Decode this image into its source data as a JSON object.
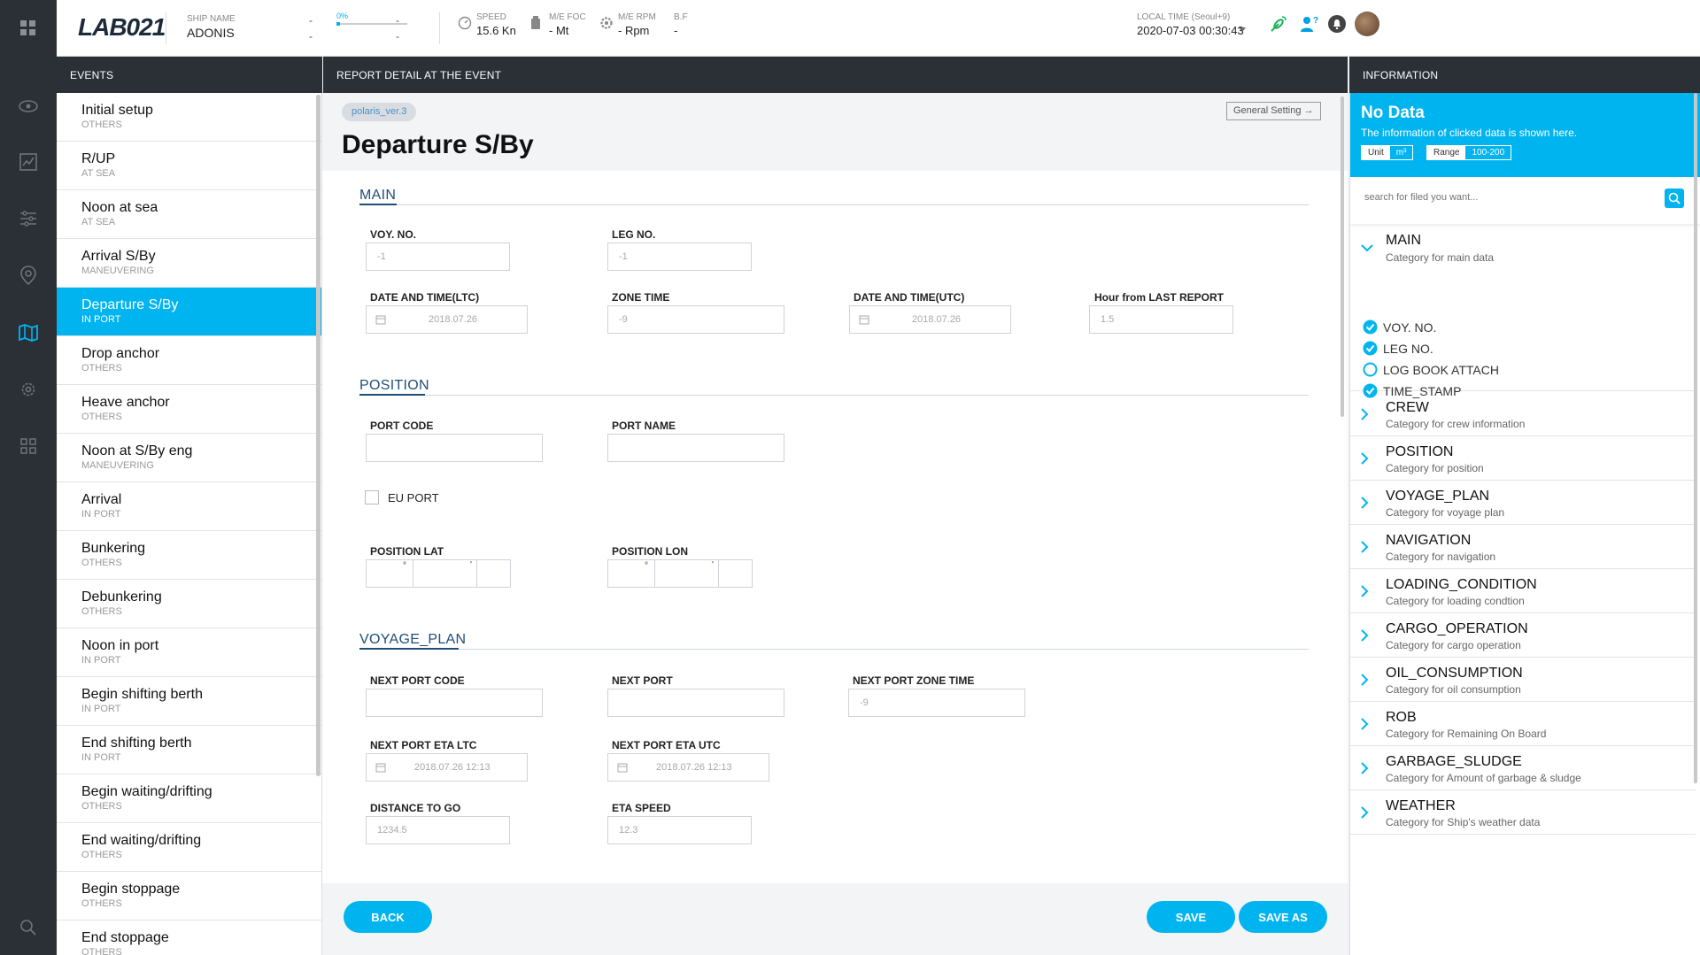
{
  "header": {
    "logo": "LAB021",
    "ship_name_label": "SHIP NAME",
    "ship_name": "ADONIS",
    "dash1a": "-",
    "dash1b": "-",
    "progress_label": "0%",
    "progress_fraction": 0.05,
    "dash2a": "-",
    "dash2b": "-",
    "speed_label": "SPEED",
    "speed_value": "15.6 Kn",
    "foc_label": "M/E FOC",
    "foc_value": "- Mt",
    "rpm_label": "M/E RPM",
    "rpm_value": "- Rpm",
    "bf_label": "B.F",
    "bf_value": "-",
    "time_label": "LOCAL TIME (Seoul+9)",
    "time_value": "2020-07-03 00:30:43"
  },
  "nav": {
    "icons": [
      "apps-icon",
      "eye-icon",
      "chart-icon",
      "sliders-icon",
      "location-icon",
      "map-icon",
      "settings-icon",
      "grid-icon",
      "search-icon"
    ]
  },
  "panels": {
    "events_title": "EVENTS",
    "report_title": "REPORT DETAIL AT THE EVENT",
    "info_title": "INFORMATION"
  },
  "events": [
    {
      "title": "Initial setup",
      "sub": "OTHERS"
    },
    {
      "title": "R/UP",
      "sub": "AT SEA"
    },
    {
      "title": "Noon at sea",
      "sub": "AT SEA"
    },
    {
      "title": "Arrival S/By",
      "sub": "MANEUVERING"
    },
    {
      "title": "Departure S/By",
      "sub": "IN PORT"
    },
    {
      "title": "Drop anchor",
      "sub": "OTHERS"
    },
    {
      "title": "Heave anchor",
      "sub": "OTHERS"
    },
    {
      "title": "Noon at S/By eng",
      "sub": "MANEUVERING"
    },
    {
      "title": "Arrival",
      "sub": "IN PORT"
    },
    {
      "title": "Bunkering",
      "sub": "OTHERS"
    },
    {
      "title": "Debunkering",
      "sub": "OTHERS"
    },
    {
      "title": "Noon in port",
      "sub": "IN PORT"
    },
    {
      "title": "Begin shifting berth",
      "sub": "IN PORT"
    },
    {
      "title": "End shifting berth",
      "sub": "IN PORT"
    },
    {
      "title": "Begin waiting/drifting",
      "sub": "OTHERS"
    },
    {
      "title": "End waiting/drifting",
      "sub": "OTHERS"
    },
    {
      "title": "Begin stoppage",
      "sub": "OTHERS"
    },
    {
      "title": "End stoppage",
      "sub": "OTHERS"
    }
  ],
  "report": {
    "version_tag": "polaris_ver.3",
    "general_setting": "General Setting →",
    "title": "Departure S/By",
    "main": {
      "heading": "MAIN",
      "voy_no_label": "VOY. NO.",
      "voy_no_value": "-1",
      "leg_no_label": "LEG NO.",
      "leg_no_value": "-1",
      "dt_ltc_label": "DATE AND TIME(LTC)",
      "dt_ltc_value": "2018.07.26",
      "zone_time_label": "ZONE TIME",
      "zone_time_value": "-9",
      "dt_utc_label": "DATE AND TIME(UTC)",
      "dt_utc_value": "2018.07.26",
      "hour_label": "Hour from LAST REPORT",
      "hour_value": "1.5"
    },
    "position": {
      "heading": "POSITION",
      "port_code_label": "PORT CODE",
      "port_code_value": "",
      "port_name_label": "PORT NAME",
      "port_name_value": "",
      "eu_port_label": "EU PORT",
      "lat_label": "POSITION LAT",
      "lon_label": "POSITION LON",
      "deg_mark": "°",
      "min_mark": "'"
    },
    "voyage_plan": {
      "heading": "VOYAGE_PLAN",
      "next_code_label": "NEXT PORT CODE",
      "next_code_value": "",
      "next_port_label": "NEXT PORT",
      "next_port_value": "",
      "next_zone_label": "NEXT PORT ZONE TIME",
      "next_zone_value": "-9",
      "eta_ltc_label": "NEXT PORT ETA LTC",
      "eta_ltc_value": "2018.07.26 12:13",
      "eta_utc_label": "NEXT PORT ETA UTC",
      "eta_utc_value": "2018.07.26 12:13",
      "dist_label": "DISTANCE TO GO",
      "dist_value": "1234.5",
      "eta_speed_label": "ETA SPEED",
      "eta_speed_value": "12.3"
    },
    "back": "BACK",
    "save": "SAVE",
    "save_as": "SAVE AS"
  },
  "info": {
    "title": "No Data",
    "desc": "The information of clicked data is shown here.",
    "unit_label": "Unit",
    "unit_value": "m³",
    "range_label": "Range",
    "range_value": "100-200",
    "search_placeholder": "search for filed you want...",
    "main": {
      "title": "MAIN",
      "sub": "Category for main data"
    },
    "checks": [
      {
        "label": "VOY. NO.",
        "checked": true
      },
      {
        "label": "LEG NO.",
        "checked": true
      },
      {
        "label": "LOG BOOK ATTACH",
        "checked": false
      },
      {
        "label": "TIME_STAMP",
        "checked": true
      }
    ],
    "categories": [
      {
        "title": "CREW",
        "sub": "Category for crew information"
      },
      {
        "title": "POSITION",
        "sub": "Category for position"
      },
      {
        "title": "VOYAGE_PLAN",
        "sub": "Category for voyage plan"
      },
      {
        "title": "NAVIGATION",
        "sub": "Category for navigation"
      },
      {
        "title": "LOADING_CONDITION",
        "sub": "Category for loading condtion"
      },
      {
        "title": "CARGO_OPERATION",
        "sub": "Category for cargo operation"
      },
      {
        "title": "OIL_CONSUMPTION",
        "sub": "Category for oil consumption"
      },
      {
        "title": "ROB",
        "sub": "Category for Remaining On Board"
      },
      {
        "title": "GARBAGE_SLUDGE",
        "sub": "Category for Amount of garbage & sludge"
      },
      {
        "title": "WEATHER",
        "sub": "Category for Ship's weather data"
      }
    ],
    "accent": "#00b4f0"
  }
}
